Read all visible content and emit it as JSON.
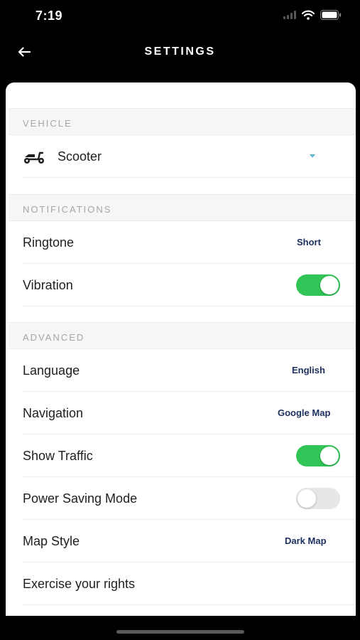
{
  "status": {
    "time": "7:19"
  },
  "header": {
    "title": "SETTINGS"
  },
  "sections": {
    "vehicle": {
      "title": "VEHICLE",
      "vehicle_type": "Scooter"
    },
    "notifications": {
      "title": "NOTIFICATIONS",
      "ringtone_label": "Ringtone",
      "ringtone_value": "Short",
      "vibration_label": "Vibration",
      "vibration_enabled": true
    },
    "advanced": {
      "title": "ADVANCED",
      "language_label": "Language",
      "language_value": "English",
      "navigation_label": "Navigation",
      "navigation_value": "Google Map",
      "traffic_label": "Show Traffic",
      "traffic_enabled": true,
      "power_label": "Power Saving Mode",
      "power_enabled": false,
      "mapstyle_label": "Map Style",
      "mapstyle_value": "Dark Map",
      "rights_label": "Exercise your rights"
    }
  },
  "colors": {
    "toggle_on": "#31c557",
    "toggle_off": "#e7e7e9",
    "value_text": "#1b2f5e",
    "caret": "#5ab7d8"
  },
  "icons": [
    "signal-icon",
    "wifi-icon",
    "battery-icon",
    "back-arrow-icon",
    "scooter-icon",
    "chevron-down-icon"
  ]
}
